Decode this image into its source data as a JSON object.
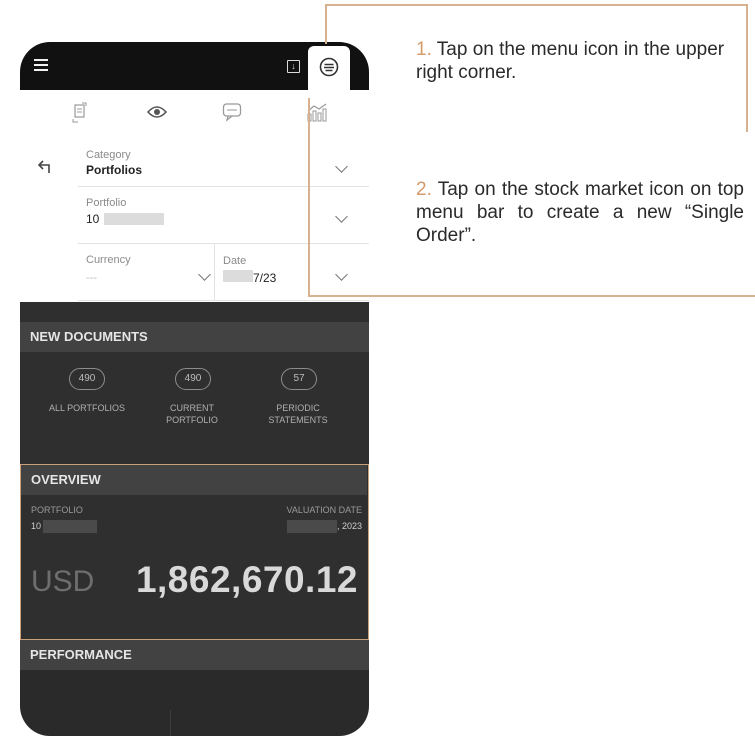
{
  "instructions": {
    "step1_num": "1.",
    "step1_text": " Tap on the menu icon in the upper right corner.",
    "step2_num": "2.",
    "step2_text": " Tap on the stock market icon on top menu bar to create a new “Single Order”."
  },
  "form": {
    "category_label": "Category",
    "category_value": "Portfolios",
    "portfolio_label": "Portfolio",
    "portfolio_value": "10",
    "currency_label": "Currency",
    "currency_value": "---",
    "date_label": "Date",
    "date_value": "7/23"
  },
  "new_documents": {
    "title": "NEW DOCUMENTS",
    "items": [
      {
        "count": "490",
        "label_line1": "ALL PORTFOLIOS",
        "label_line2": ""
      },
      {
        "count": "490",
        "label_line1": "CURRENT",
        "label_line2": "PORTFOLIO"
      },
      {
        "count": "57",
        "label_line1": "PERIODIC",
        "label_line2": "STATEMENTS"
      }
    ]
  },
  "overview": {
    "title": "OVERVIEW",
    "portfolio_label": "PORTFOLIO",
    "portfolio_value": "10",
    "valuation_label": "VALUATION DATE",
    "valuation_value": ", 2023",
    "currency": "USD",
    "amount": "1,862,670.12"
  },
  "performance": {
    "title": "PERFORMANCE"
  },
  "colors": {
    "accent": "#d49b6a",
    "callout_line": "#d6b28f",
    "dark_panel": "#2f2f2f",
    "section_header": "#424242"
  }
}
